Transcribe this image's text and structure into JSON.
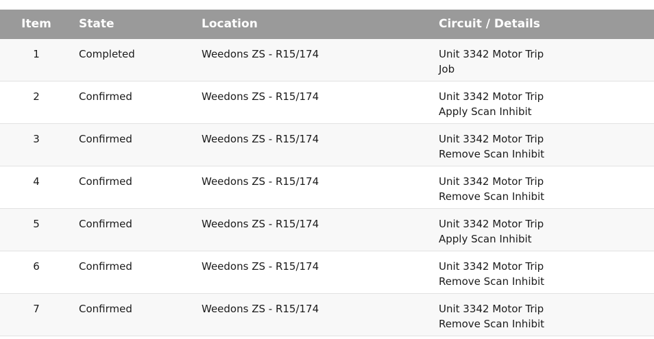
{
  "table": {
    "headers": {
      "item": "Item",
      "state": "State",
      "location": "Location",
      "circuit": "Circuit / Details"
    },
    "rows": [
      {
        "item": "1",
        "state": "Completed",
        "location": "Weedons ZS - R15/174",
        "circuit": "Unit 3342 Motor Trip",
        "details": "Job"
      },
      {
        "item": "2",
        "state": "Confirmed",
        "location": "Weedons ZS - R15/174",
        "circuit": "Unit 3342 Motor Trip",
        "details": "Apply Scan Inhibit"
      },
      {
        "item": "3",
        "state": "Confirmed",
        "location": "Weedons ZS - R15/174",
        "circuit": "Unit 3342 Motor Trip",
        "details": "Remove Scan Inhibit"
      },
      {
        "item": "4",
        "state": "Confirmed",
        "location": "Weedons ZS - R15/174",
        "circuit": "Unit 3342 Motor Trip",
        "details": "Remove Scan Inhibit"
      },
      {
        "item": "5",
        "state": "Confirmed",
        "location": "Weedons ZS - R15/174",
        "circuit": "Unit 3342 Motor Trip",
        "details": "Apply Scan Inhibit"
      },
      {
        "item": "6",
        "state": "Confirmed",
        "location": "Weedons ZS - R15/174",
        "circuit": "Unit 3342 Motor Trip",
        "details": "Remove Scan Inhibit"
      },
      {
        "item": "7",
        "state": "Confirmed",
        "location": "Weedons ZS - R15/174",
        "circuit": "Unit 3342 Motor Trip",
        "details": "Remove Scan Inhibit"
      }
    ]
  },
  "colors": {
    "header_bg": "#9a9a9a",
    "header_text": "#ffffff",
    "row_alt_bg": "#f8f8f8",
    "row_bg": "#ffffff",
    "divider": "#e2e2e2"
  }
}
